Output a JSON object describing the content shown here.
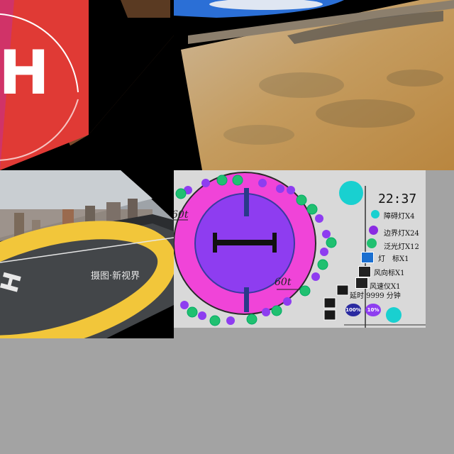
{
  "panel": {
    "clock": "22:37",
    "legend": [
      {
        "label": "障碍灯X4",
        "color": "#19d0d0",
        "icon": "obstacle-light-icon"
      },
      {
        "label": "边界灯X24",
        "color": "#8a2be2",
        "icon": "boundary-light-icon"
      },
      {
        "label": "泛光灯X12",
        "color": "#20c070",
        "icon": "floodlight-icon"
      },
      {
        "label": "灯　标X1",
        "color": "#1a6fd0",
        "icon": "beacon-icon"
      },
      {
        "label": "风向标X1",
        "color": "#222222",
        "icon": "windsock-icon"
      },
      {
        "label": "风速仪X1",
        "color": "#222222",
        "icon": "anemometer-icon"
      }
    ],
    "delay_label": "延时 9999 分钟",
    "buttons": [
      "100%",
      "10%"
    ],
    "ring_labels": [
      "60t",
      "60t"
    ],
    "pad_letter": "H"
  },
  "watermark": "摄图·新视界",
  "pad_letter_red": "H",
  "pad_letter_yellow": "H",
  "colors": {
    "pad_magenta": "#f044d8",
    "pad_purple": "#8e3df0",
    "red_pad": "#e03a35",
    "yellow_ring": "#f2c63a",
    "panel_bg": "#d9d9d9"
  }
}
